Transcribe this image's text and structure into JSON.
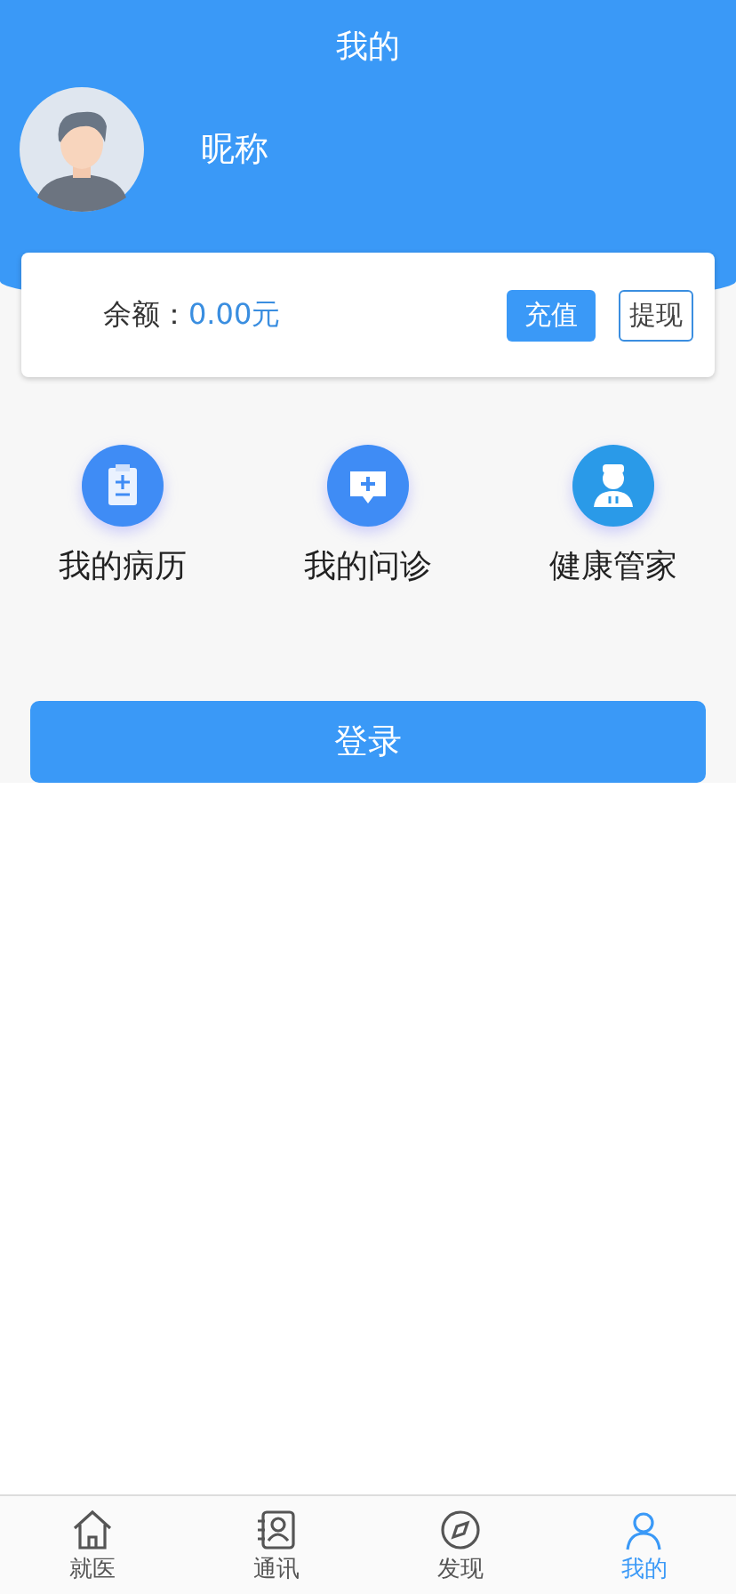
{
  "header": {
    "title": "我的"
  },
  "profile": {
    "nickname": "昵称"
  },
  "balance": {
    "label": "余额：",
    "amount": "0.00元",
    "buttons": [
      {
        "kind": "primary",
        "label": "充值"
      },
      {
        "kind": "outline",
        "label": "提现"
      }
    ]
  },
  "shortcuts": [
    {
      "kind": "record",
      "label": "我的病历"
    },
    {
      "kind": "consult",
      "label": "我的问诊"
    },
    {
      "kind": "doctor",
      "label": "健康管家"
    }
  ],
  "login_button": "登录",
  "tabs": [
    {
      "kind": "home",
      "label": "就医",
      "selected": false
    },
    {
      "kind": "contacts",
      "label": "通讯",
      "selected": false
    },
    {
      "kind": "discover",
      "label": "发现",
      "selected": false
    },
    {
      "kind": "me",
      "label": "我的",
      "selected": true
    }
  ]
}
